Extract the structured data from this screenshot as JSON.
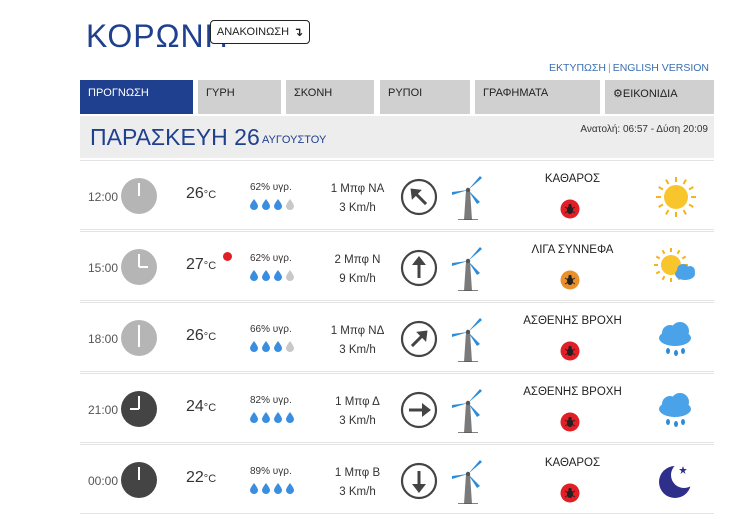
{
  "header": {
    "title": "ΚΟΡΩΝΗ",
    "announce_label": "ΑΝΑΚΟΙΝΩΣΗ",
    "print_label": "ΕΚΤΥΠΩΣΗ",
    "english_label": "ENGLISH VERSION"
  },
  "tabs": [
    {
      "label": "ΠΡΟΓΝΩΣΗ",
      "active": true
    },
    {
      "label": "ΓΥΡΗ",
      "active": false
    },
    {
      "label": "ΣΚΟΝΗ",
      "active": false
    },
    {
      "label": "ΡΥΠΟΙ",
      "active": false
    },
    {
      "label": "ΓΡΑΦΗΜΑΤΑ",
      "active": false
    },
    {
      "label": "ΕΙΚΟΝΙΔΙΑ",
      "active": false,
      "icon": "gear-icon"
    }
  ],
  "day": {
    "name": "ΠΑΡΑΣΚΕΥΗ 26",
    "month": "ΑΥΓΟΥΣΤΟΥ",
    "sun": "Ανατολή: 06:57  - Δύση 20:09"
  },
  "colors": {
    "brand_blue": "#1f3f8f",
    "alert_red": "#e21e26",
    "badge_orange": "#e8902a",
    "drop_blue": "#3a8ee0",
    "drop_grey": "#c8c8c8"
  },
  "forecast": [
    {
      "time": "12:00",
      "clock": "light",
      "hour": 12,
      "temp": "26",
      "temp_unit": "°C",
      "max_marker": false,
      "humidity": "62% υγρ.",
      "drops_filled": 3,
      "wind_bft": "1 Μπφ ΝΑ",
      "wind_speed": "3 Km/h",
      "wind_arrow_deg": -45,
      "condition": "ΚΑΘΑΡΟΣ",
      "badge": "red",
      "weather_icon": "sun-icon"
    },
    {
      "time": "15:00",
      "clock": "light",
      "hour": 15,
      "temp": "27",
      "temp_unit": "°C",
      "max_marker": true,
      "humidity": "62% υγρ.",
      "drops_filled": 3,
      "wind_bft": "2 Μπφ Ν",
      "wind_speed": "9 Km/h",
      "wind_arrow_deg": 0,
      "condition": "ΛΙΓΑ ΣΥΝΝΕΦΑ",
      "badge": "orange",
      "weather_icon": "sun-cloud-icon"
    },
    {
      "time": "18:00",
      "clock": "light",
      "hour": 18,
      "temp": "26",
      "temp_unit": "°C",
      "max_marker": false,
      "humidity": "66% υγρ.",
      "drops_filled": 3,
      "wind_bft": "1 Μπφ ΝΔ",
      "wind_speed": "3 Km/h",
      "wind_arrow_deg": 45,
      "condition": "ΑΣΘΕΝΗΣ ΒΡΟΧΗ",
      "badge": "red",
      "weather_icon": "rain-cloud-icon"
    },
    {
      "time": "21:00",
      "clock": "dark",
      "hour": 21,
      "temp": "24",
      "temp_unit": "°C",
      "max_marker": false,
      "humidity": "82% υγρ.",
      "drops_filled": 4,
      "wind_bft": "1 Μπφ Δ",
      "wind_speed": "3 Km/h",
      "wind_arrow_deg": 90,
      "condition": "ΑΣΘΕΝΗΣ ΒΡΟΧΗ",
      "badge": "red",
      "weather_icon": "rain-cloud-icon"
    },
    {
      "time": "00:00",
      "clock": "dark",
      "hour": 0,
      "temp": "22",
      "temp_unit": "°C",
      "max_marker": false,
      "humidity": "89% υγρ.",
      "drops_filled": 4,
      "wind_bft": "1 Μπφ Β",
      "wind_speed": "3 Km/h",
      "wind_arrow_deg": 180,
      "condition": "ΚΑΘΑΡΟΣ",
      "badge": "red",
      "weather_icon": "moon-icon"
    }
  ]
}
